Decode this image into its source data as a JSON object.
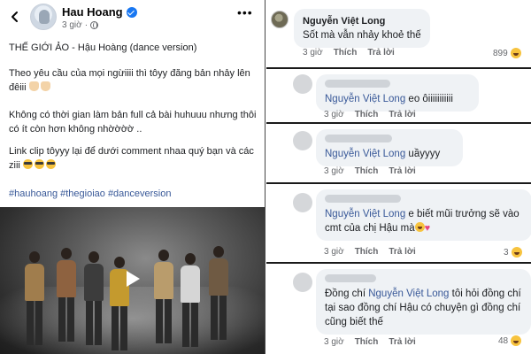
{
  "post": {
    "author": "Hau Hoang",
    "time": "3 giờ",
    "title_line": "THẾ GIỚI ẢO - Hậu Hoàng (dance version)",
    "para1": "Theo yêu cầu của mọi ngừiiii thì tôyy đăng bản nhảy lên đêiii",
    "para2": "Không có thời gian làm bản full cả bài huhuuu nhưng thôi có ít còn hơn không nhờờờờ ..",
    "para3": "Link clip tôyyy lại để dưới comment nhaa quý bạn và các ziii",
    "hashtags": "#hauhoang #thegioiao #danceversion"
  },
  "comments": [
    {
      "author": "Nguyễn Việt Long",
      "text": "Sốt mà vẫn nhảy khoẻ thế",
      "time": "3 giờ",
      "like": "Thích",
      "reply": "Trả lời",
      "reactions": "899"
    },
    {
      "mention": "Nguyễn Việt Long",
      "text": " eo ôiiiiiiiiiii",
      "time": "3 giờ",
      "like": "Thích",
      "reply": "Trả lời",
      "reactions": ""
    },
    {
      "mention": "Nguyễn Việt Long",
      "text": " uầyyyy",
      "time": "3 giờ",
      "like": "Thích",
      "reply": "Trả lời",
      "reactions": ""
    },
    {
      "mention": "Nguyễn Việt Long",
      "text": " e biết mũi trưởng sẽ vào cmt của chị Hậu mà",
      "time": "3 giờ",
      "like": "Thích",
      "reply": "Trả lời",
      "reactions": "3"
    },
    {
      "prefix": "Đồng chí ",
      "mention": "Nguyễn Việt Long",
      "text": " tôi hỏi đồng chí tại sao đồng chí Hậu có chuyện gì đồng chí cũng biết thế",
      "time": "3 giờ",
      "like": "Thích",
      "reply": "Trả lời",
      "reactions": "48"
    }
  ],
  "icons": {
    "back": "arrow-left-icon",
    "verified": "verified-badge-icon",
    "globe": "globe-icon",
    "more": "more-dots-icon",
    "play": "play-icon",
    "reaction": "haha-reaction-icon"
  },
  "colors": {
    "link": "#385898",
    "verified": "#1877f2",
    "bubble": "#eff2f5",
    "meta": "#65676b"
  }
}
